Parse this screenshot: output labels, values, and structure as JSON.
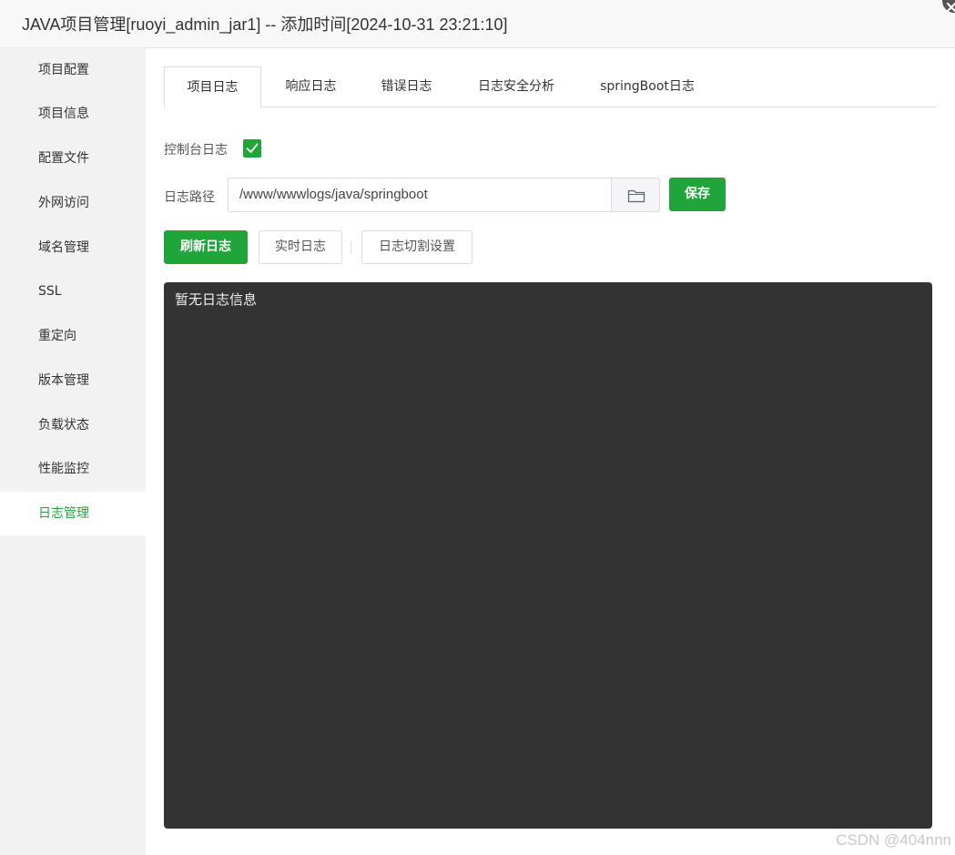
{
  "window": {
    "title": "JAVA项目管理[ruoyi_admin_jar1] -- 添加时间[2024-10-31 23:21:10]"
  },
  "sidebar": {
    "items": [
      {
        "label": "项目配置"
      },
      {
        "label": "项目信息"
      },
      {
        "label": "配置文件"
      },
      {
        "label": "外网访问"
      },
      {
        "label": "域名管理"
      },
      {
        "label": "SSL"
      },
      {
        "label": "重定向"
      },
      {
        "label": "版本管理"
      },
      {
        "label": "负载状态"
      },
      {
        "label": "性能监控"
      },
      {
        "label": "日志管理"
      }
    ],
    "active_index": 10
  },
  "tabs": [
    {
      "label": "项目日志"
    },
    {
      "label": "响应日志"
    },
    {
      "label": "错误日志"
    },
    {
      "label": "日志安全分析"
    },
    {
      "label": "springBoot日志"
    }
  ],
  "console_log": {
    "label": "控制台日志",
    "checked": true
  },
  "log_path": {
    "label": "日志路径",
    "value": "/www/wwwlogs/java/springboot",
    "save_label": "保存"
  },
  "actions": {
    "refresh_label": "刷新日志",
    "realtime_label": "实时日志",
    "rotate_label": "日志切割设置"
  },
  "log_output": {
    "text": "暂无日志信息"
  },
  "watermark": "CSDN @404nnn",
  "colors": {
    "accent": "#20a53a",
    "log_background": "#333333",
    "sidebar_background": "#f2f2f2"
  }
}
